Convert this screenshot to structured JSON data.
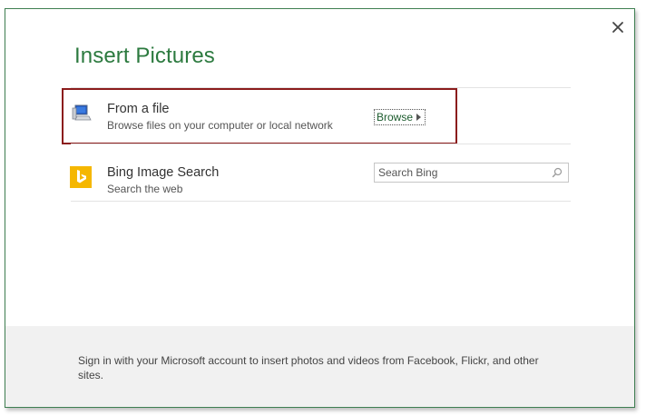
{
  "dialog": {
    "title": "Insert Pictures",
    "close_icon": "close-icon",
    "accent_color": "#2c7a3f"
  },
  "sources": {
    "file": {
      "title": "From a file",
      "subtitle": "Browse files on your computer or local network",
      "icon": "computer-icon",
      "action_label": "Browse"
    },
    "bing": {
      "title": "Bing Image Search",
      "subtitle": "Search the web",
      "icon": "bing-logo-icon",
      "search_placeholder": "Search Bing",
      "search_value": "",
      "search_icon": "search-icon"
    }
  },
  "footer": {
    "text": "Sign in with your Microsoft account to insert photos and videos from Facebook, Flickr, and other sites."
  }
}
